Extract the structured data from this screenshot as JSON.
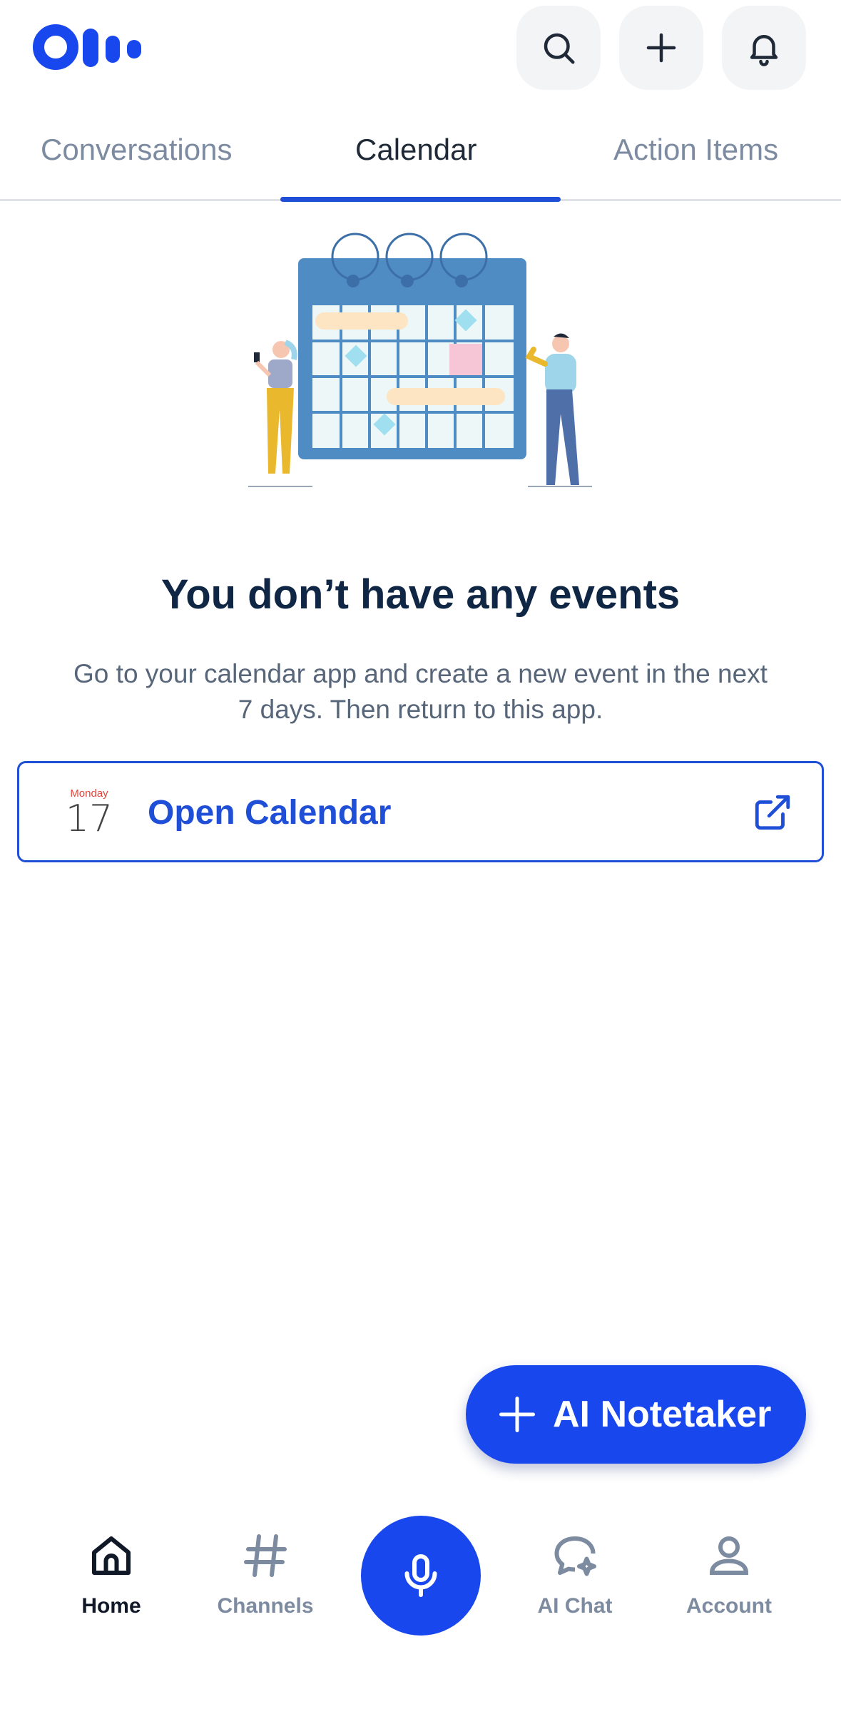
{
  "header": {
    "logo_icon": "otter-logo",
    "buttons": [
      {
        "icon": "search-icon"
      },
      {
        "icon": "plus-icon"
      },
      {
        "icon": "bell-icon"
      }
    ]
  },
  "tabs": [
    {
      "label": "Conversations",
      "active": false
    },
    {
      "label": "Calendar",
      "active": true
    },
    {
      "label": "Action Items",
      "active": false
    }
  ],
  "empty_state": {
    "illustration": "calendar-illustration",
    "title": "You don’t have any events",
    "description": "Go to your calendar app and create a new event in the next 7 days. Then return to this app."
  },
  "open_calendar": {
    "icon_day": "Monday",
    "icon_date": "17",
    "label": "Open Calendar",
    "action_icon": "external-link-icon"
  },
  "fab": {
    "icon": "plus-icon",
    "label": "AI Notetaker"
  },
  "bottom_nav": {
    "items": [
      {
        "label": "Home",
        "icon": "home-icon",
        "active": true
      },
      {
        "label": "Channels",
        "icon": "hash-icon",
        "active": false
      },
      {
        "label": "AI Chat",
        "icon": "ai-chat-icon",
        "active": false
      },
      {
        "label": "Account",
        "icon": "account-icon",
        "active": false
      }
    ],
    "record_icon": "microphone-icon"
  },
  "colors": {
    "brand_blue": "#1947ee",
    "accent_blue": "#1f4fd6",
    "title_text": "#0f2745",
    "muted_text": "#7d8ba0"
  }
}
